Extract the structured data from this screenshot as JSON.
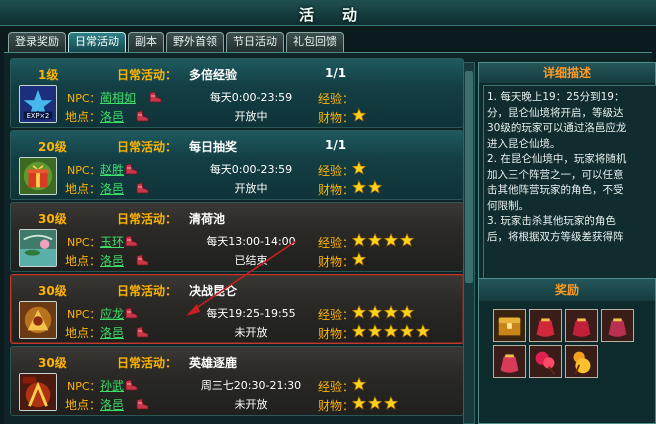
{
  "window": {
    "title": "活动"
  },
  "tabs": [
    {
      "label": "登录奖励",
      "active": false
    },
    {
      "label": "日常活动",
      "active": true
    },
    {
      "label": "副本",
      "active": false
    },
    {
      "label": "野外首领",
      "active": false
    },
    {
      "label": "节日活动",
      "active": false
    },
    {
      "label": "礼包回馈",
      "active": false
    }
  ],
  "labels": {
    "npc": "NPC：",
    "location": "地点：",
    "exp": "经验：",
    "resources": "财物："
  },
  "activities": [
    {
      "level": "1级",
      "category": "日常活动：",
      "name": "多倍经验",
      "count": "1/1",
      "npc": "蔺相如",
      "location": "洛邑",
      "time": "每天0:00-23:59",
      "status": "开放中",
      "exp_stars": 0,
      "res_stars": 1,
      "icon": "exp-x2-icon",
      "style": "teal"
    },
    {
      "level": "20级",
      "category": "日常活动：",
      "name": "每日抽奖",
      "count": "1/1",
      "npc": "赵胜",
      "location": "洛邑",
      "time": "每天0:00-23:59",
      "status": "开放中",
      "exp_stars": 1,
      "res_stars": 2,
      "icon": "gift-icon",
      "style": "teal"
    },
    {
      "level": "30级",
      "category": "日常活动：",
      "name": "清荷池",
      "count": "",
      "npc": "玉环",
      "location": "洛邑",
      "time": "每天13:00-14:00",
      "status": "已结束",
      "exp_stars": 4,
      "res_stars": 1,
      "icon": "lotus-pond-icon",
      "style": "dark"
    },
    {
      "level": "30级",
      "category": "日常活动：",
      "name": "决战昆仑",
      "count": "",
      "npc": "应龙",
      "location": "洛邑",
      "time": "每天19:25-19:55",
      "status": "未开放",
      "exp_stars": 4,
      "res_stars": 5,
      "icon": "battle-icon",
      "style": "dark",
      "selected": true
    },
    {
      "level": "30级",
      "category": "日常活动：",
      "name": "英雄逐鹿",
      "count": "",
      "npc": "孙武",
      "location": "洛邑",
      "time": "周三七20:30-21:30",
      "status": "未开放",
      "exp_stars": 1,
      "res_stars": 3,
      "icon": "hero-icon",
      "style": "dark"
    }
  ],
  "detail": {
    "title": "详细描述",
    "lines": [
      "1. 每天晚上19：25分到19：",
      "分，昆仑仙境将开启，等级达",
      "30级的玩家可以通过洛邑应龙",
      "进入昆仑仙境。",
      "2. 在昆仑仙境中，玩家将随机",
      "加入三个阵营之一，可以任意",
      "击其他阵营玩家的角色，不受",
      "何限制。",
      "3. 玩家击杀其他玩家的角色",
      "后，将根据双方等级差获得阵"
    ]
  },
  "reward": {
    "title": "奖励",
    "items": [
      "treasure-chest-icon",
      "red-pouch-icon",
      "red-pouch-icon",
      "red-pouch-icon",
      "red-pouch-icon",
      "fire-lotus-icon",
      "golden-gourd-icon"
    ]
  },
  "colors": {
    "accent": "#ffb400",
    "link": "#3fe06a",
    "panel_title": "#ff9b24",
    "selection": "#c0392b"
  }
}
